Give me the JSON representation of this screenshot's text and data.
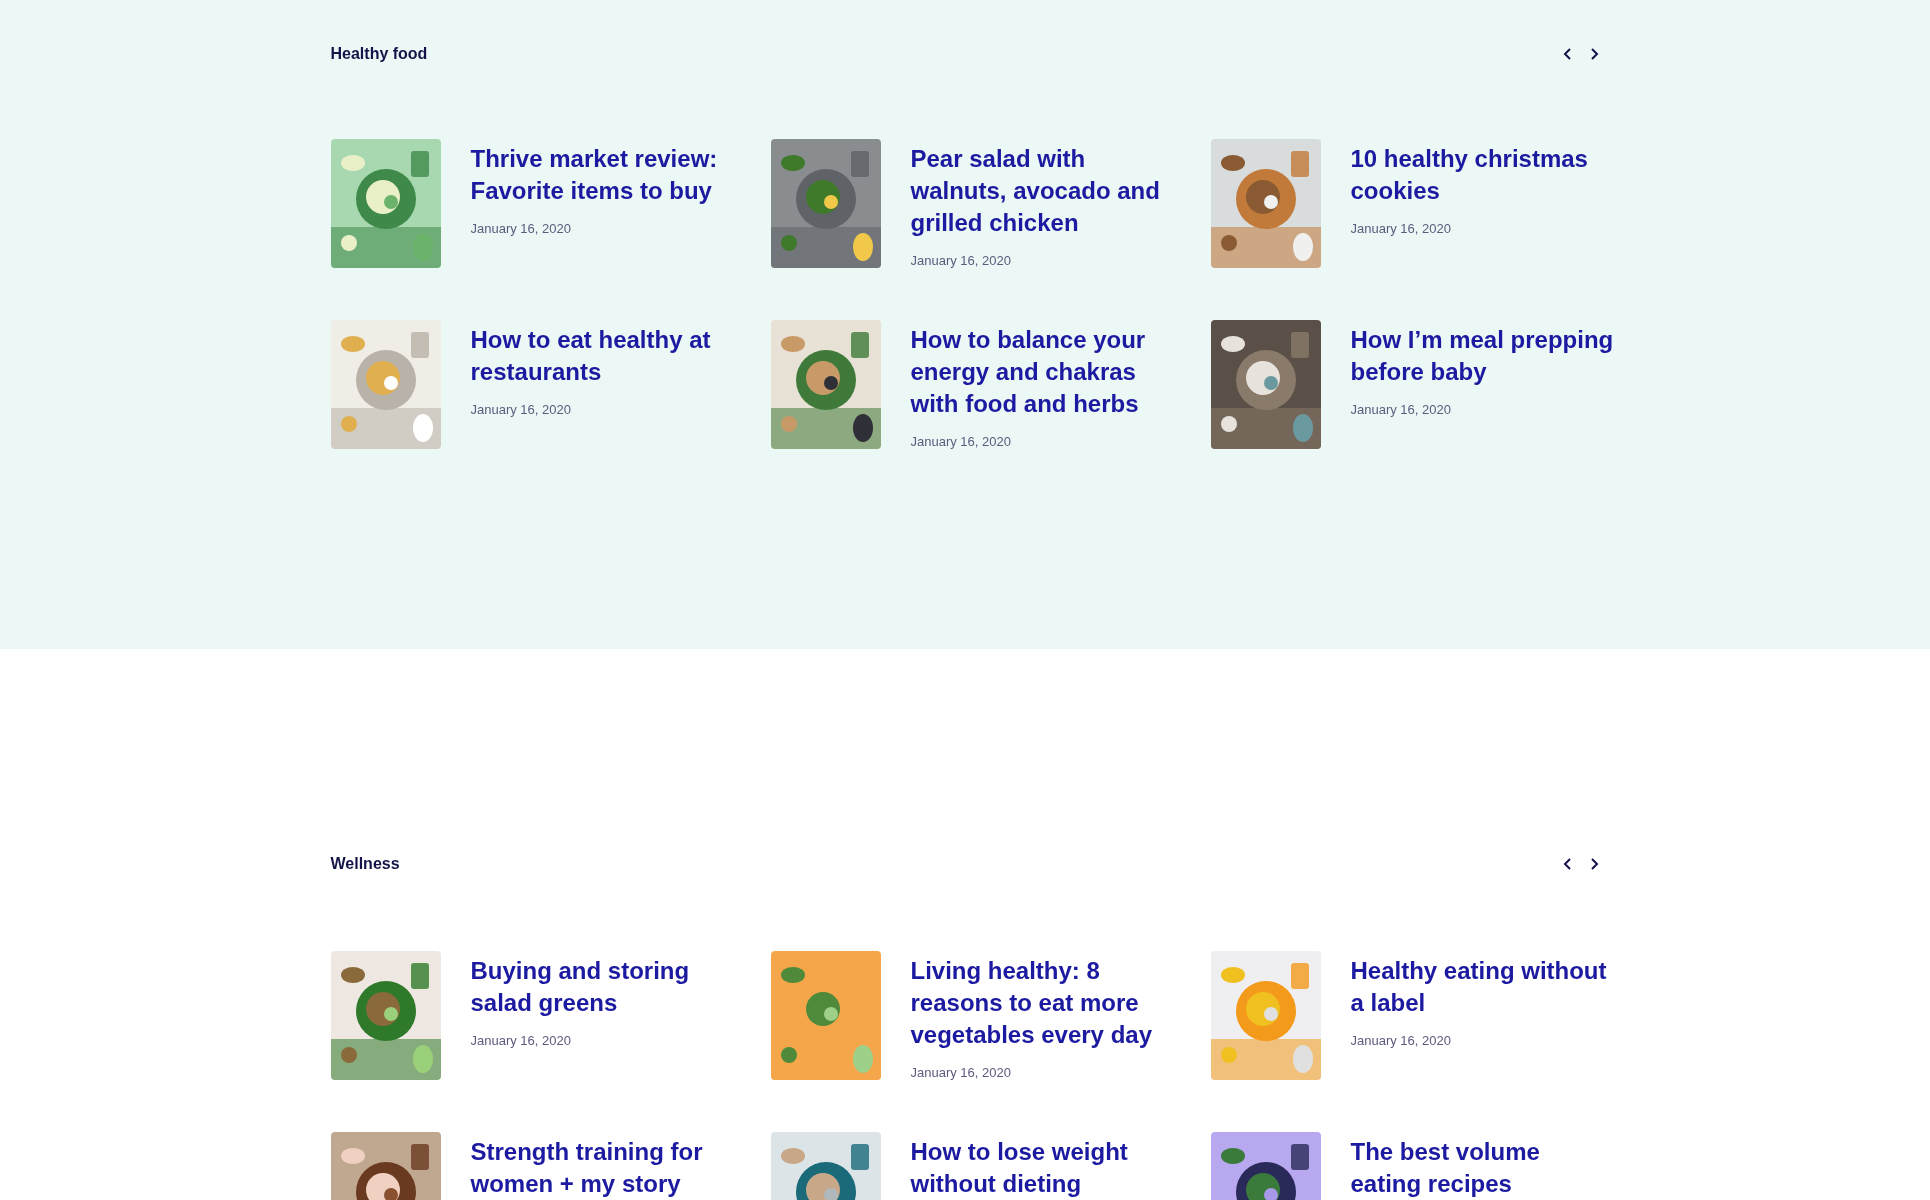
{
  "sections": [
    {
      "title": "Healthy food",
      "tinted": true,
      "posts": [
        {
          "title": "Thrive market review: Favorite items to buy",
          "date": "January 16, 2020"
        },
        {
          "title": "Pear salad with walnuts, avocado and grilled chicken",
          "date": "January 16, 2020"
        },
        {
          "title": "10 healthy christmas cookies",
          "date": "January 16, 2020"
        },
        {
          "title": "How to eat healthy at restaurants",
          "date": "January 16, 2020"
        },
        {
          "title": "How to balance your energy and chakras with food and herbs",
          "date": "January 16, 2020"
        },
        {
          "title": "How I’m meal prepping before baby",
          "date": "January 16, 2020"
        }
      ]
    },
    {
      "title": "Wellness",
      "tinted": false,
      "posts": [
        {
          "title": "Buying and storing salad greens",
          "date": "January 16, 2020"
        },
        {
          "title": "Living healthy: 8 reasons to eat more vegetables every day",
          "date": "January 16, 2020"
        },
        {
          "title": "Healthy eating without a label",
          "date": "January 16, 2020"
        },
        {
          "title": "Strength training for women + my story"
        },
        {
          "title": "How to lose weight without dieting"
        },
        {
          "title": "The best volume eating recipes"
        }
      ]
    }
  ]
}
